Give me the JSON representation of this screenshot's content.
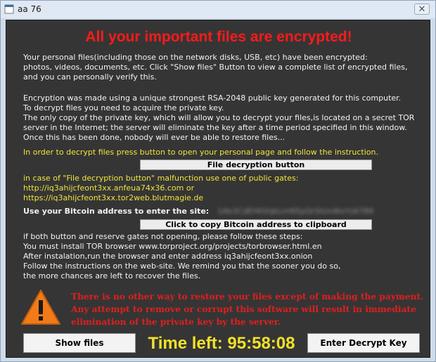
{
  "window": {
    "title": "aa 76",
    "close_glyph": "✕",
    "title_icon": "app-icon"
  },
  "headline": "All your important files are encrypted!",
  "intro": [
    "Your personal files(including those on the network disks, USB, etc) have been encrypted:",
    "photos, videos, documents, etc. Click \"Show files\" Button to view a complete list of encrypted files,",
    "and you can personally verify this."
  ],
  "encryption_info": [
    "Encryption was made using a unique strongest RSA-2048 public key generated for this computer.",
    "To decrypt files you need to acquire the private key.",
    "The only copy of the private key, which will allow you to decrypt your files,is located on a secret TOR",
    "server in the Internet; the server will eliminate the key after a time period specified in this window.",
    "Once this has been done, nobody will ever be able to restore files..."
  ],
  "instruction": "In order to decrypt files press button to open your personal page and follow the instruction.",
  "file_decryption_button": "File decryption button",
  "gates": [
    "in case of \"File decryption button\" malfunction use one of public gates:",
    "http://iq3ahijcfeont3xx.anfeua74x36.com or",
    "https://iq3ahijcfeont3xx.tor2web.blutmagie.de"
  ],
  "bitcoin_label": "Use your Bitcoin address to  enter the site:",
  "bitcoin_address": "1Ab3CdEf4GhJkLmN5pQrStUvWxYz6789",
  "copy_button": "Click to copy Bitcoin address to clipboard",
  "tor_steps": [
    "if both button and reserve gates not opening, please follow these steps:",
    "You must install TOR browser www.torproject.org/projects/torbrowser.html.en",
    "After instalation,run the browser and enter address iq3ahijcfeont3xx.onion",
    "Follow the instructions on the web-site. We remind you that the sooner you do so,",
    "the more chances are left to recover the files."
  ],
  "warning": [
    "There is no other way to restore your files except of making the payment.",
    "Any attempt to remove or corrupt this software will result in immediate",
    "elimination of the private key by the server."
  ],
  "warning_icon": "warning-triangle-icon",
  "show_files_button": "Show files",
  "time_left": "Time left: 95:58:08",
  "enter_key_button": "Enter Decrypt Key",
  "colors": {
    "background": "#353535",
    "headline_red": "#ff1a1a",
    "warning_red": "#e01f1f",
    "yellow": "#f0e43c",
    "timer_yellow": "#f2e12a"
  }
}
